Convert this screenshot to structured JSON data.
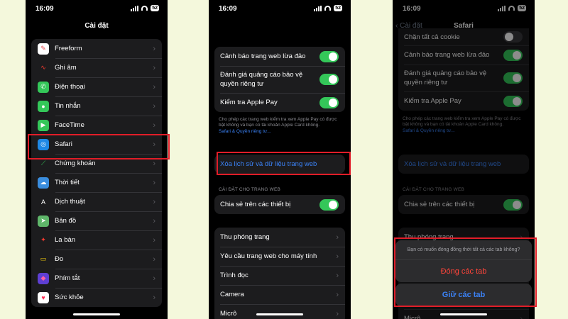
{
  "status": {
    "time": "16:09",
    "battery": "52"
  },
  "screen1": {
    "title": "Cài đặt",
    "items": [
      {
        "label": "Freeform",
        "icon": "freeform-icon",
        "color": "#ffffff",
        "glyph": "✎",
        "glyphColor": "#e5484d"
      },
      {
        "label": "Ghi âm",
        "icon": "voice-memos-icon",
        "color": "#1c1c1e",
        "glyph": "∿",
        "glyphColor": "#ff3b30"
      },
      {
        "label": "Điện thoại",
        "icon": "phone-icon",
        "color": "#34c759",
        "glyph": "✆",
        "glyphColor": "#ffffff"
      },
      {
        "label": "Tin nhắn",
        "icon": "messages-icon",
        "color": "#34c759",
        "glyph": "●",
        "glyphColor": "#ffffff"
      },
      {
        "label": "FaceTime",
        "icon": "facetime-icon",
        "color": "#34c759",
        "glyph": "▶",
        "glyphColor": "#ffffff"
      },
      {
        "label": "Safari",
        "icon": "safari-icon",
        "color": "#1e88e5",
        "glyph": "◎",
        "glyphColor": "#ffffff"
      },
      {
        "label": "Chứng khoán",
        "icon": "stocks-icon",
        "color": "#1c1c1e",
        "glyph": "⟋",
        "glyphColor": "#34c759"
      },
      {
        "label": "Thời tiết",
        "icon": "weather-icon",
        "color": "#3a8dde",
        "glyph": "☁",
        "glyphColor": "#ffffff"
      },
      {
        "label": "Dịch thuật",
        "icon": "translate-icon",
        "color": "#1c1c1e",
        "glyph": "A",
        "glyphColor": "#ffffff"
      },
      {
        "label": "Bản đồ",
        "icon": "maps-icon",
        "color": "#5fb66a",
        "glyph": "➤",
        "glyphColor": "#ffffff"
      },
      {
        "label": "La bàn",
        "icon": "compass-icon",
        "color": "#1c1c1e",
        "glyph": "✦",
        "glyphColor": "#ff3b30"
      },
      {
        "label": "Đo",
        "icon": "measure-icon",
        "color": "#1c1c1e",
        "glyph": "▭",
        "glyphColor": "#ffd60a"
      },
      {
        "label": "Phím tắt",
        "icon": "shortcuts-icon",
        "color": "#5e3fd3",
        "glyph": "◆",
        "glyphColor": "#ff5fa2"
      },
      {
        "label": "Sức khỏe",
        "icon": "health-icon",
        "color": "#ffffff",
        "glyph": "♥",
        "glyphColor": "#ff2d55"
      }
    ]
  },
  "screen2": {
    "privacy": [
      {
        "label": "Cảnh báo trang web lừa đảo",
        "on": true
      },
      {
        "label": "Đánh giá quảng cáo bảo vệ quyền riêng tư",
        "on": true
      },
      {
        "label": "Kiểm tra Apple Pay",
        "on": true
      }
    ],
    "note": "Cho phép các trang web kiểm tra xem Apple Pay có được bật không và bạn có tài khoản Apple Card không.",
    "note_link": "Safari & Quyền riêng tư...",
    "clear_label": "Xóa lịch sử và dữ liệu trang web",
    "section_header": "CÀI ĐẶT CHO TRANG WEB",
    "share_label": "Chia sẻ trên các thiết bị",
    "site_settings": [
      "Thu phóng trang",
      "Yêu cầu trang web cho máy tính",
      "Trình đọc",
      "Camera",
      "Micrô"
    ]
  },
  "screen3": {
    "back": "Cài đặt",
    "title": "Safari",
    "block_cookie": "Chặn tất cả cookie",
    "sheet_message": "Bạn có muốn đóng đồng thời tất cả các tab không?",
    "close_tabs": "Đóng các tab",
    "keep_tabs": "Giữ các tab"
  },
  "colors": {
    "background": "#f4f8dc",
    "highlight": "#e11d28",
    "accent": "#3b82f6",
    "toggle_on": "#34c759"
  }
}
